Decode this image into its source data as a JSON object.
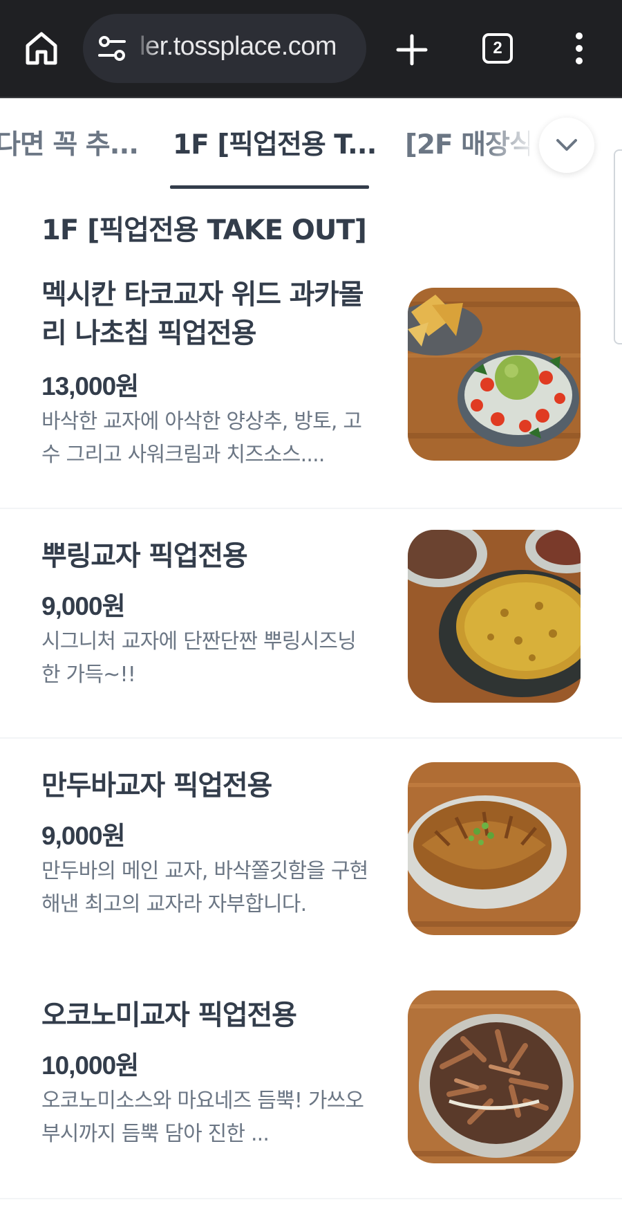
{
  "browser": {
    "url": "ler.tossplace.com",
    "tab_count": "2"
  },
  "categories": {
    "tabs": [
      {
        "label": "다면 꼭 추..."
      },
      {
        "label": "1F [픽업전용 T..."
      },
      {
        "label": "[2F 매장식"
      }
    ],
    "active_index": 1
  },
  "section": {
    "title": "1F [픽업전용 TAKE OUT]"
  },
  "menu": {
    "items": [
      {
        "name": "멕시칸 타코교자 위드 과카몰리 나초칩 픽업전용",
        "price": "13,000원",
        "desc": "바삭한 교자에 아삭한 양상추, 방토, 고수 그리고 사워크림과 치즈소스...."
      },
      {
        "name": "뿌링교자 픽업전용",
        "price": "9,000원",
        "desc": "시그니처 교자에 단짠단짠 뿌링시즈닝 한 가득~!!"
      },
      {
        "name": "만두바교자 픽업전용",
        "price": "9,000원",
        "desc": "만두바의 메인 교자, 바삭쫄깃함을 구현해낸 최고의 교자라 자부합니다."
      },
      {
        "name": "오코노미교자 픽업전용",
        "price": "10,000원",
        "desc": "오코노미소스와 마요네즈 듬뿍! 가쓰오부시까지 듬뿍 담아 진한 ..."
      }
    ]
  },
  "colors": {
    "browser_bar": "#1f2023",
    "url_pill": "#2c2e35",
    "text_primary": "#333d4b",
    "text_secondary": "#6b7684",
    "divider": "#f2f4f6"
  },
  "icons": [
    "home-icon",
    "site-settings-icon",
    "plus-icon",
    "tab-switcher-icon",
    "more-vert-icon",
    "chevron-down-icon"
  ]
}
